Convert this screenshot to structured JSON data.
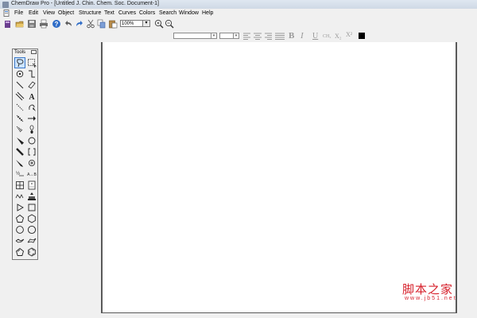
{
  "window": {
    "title": "ChemDraw Pro - [Untitled J. Chin. Chem. Soc. Document-1]"
  },
  "menu": [
    "File",
    "Edit",
    "View",
    "Object",
    "Structure",
    "Text",
    "Curves",
    "Colors",
    "Search",
    "Window",
    "Help"
  ],
  "toolbar": {
    "zoom_value": "100%",
    "zoom_arrow": "▾",
    "icons": [
      "new-doc-icon",
      "open-folder-icon",
      "save-icon",
      "print-icon",
      "help-icon",
      "undo-icon",
      "redo-icon",
      "cut-icon",
      "copy-icon",
      "paste-icon",
      "zoom-in-icon",
      "zoom-out-icon"
    ]
  },
  "format_bar": {
    "bold": "B",
    "italic": "I",
    "underline": "U",
    "formula": "CH₂",
    "subscript": "X₂",
    "superscript": "X²",
    "color_swatch": "#000000",
    "dropdown_arrow": "▾"
  },
  "tools_palette": {
    "title": "Tools"
  },
  "watermark": {
    "main": "脚本之家",
    "sub": "www.jb51.net"
  },
  "colors": {
    "canvas_border": "#5a5a5a",
    "chrome": "#f0f0f0",
    "watermark": "#d61f2a"
  }
}
